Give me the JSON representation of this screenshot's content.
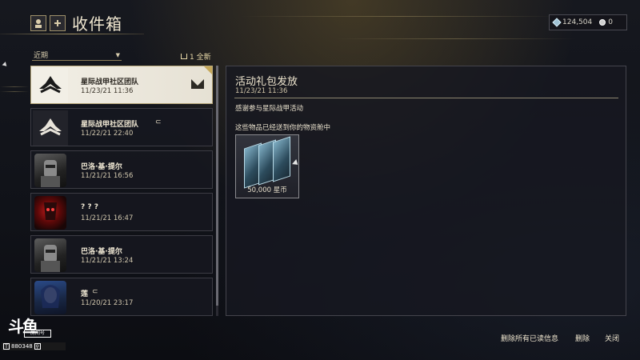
{
  "header": {
    "title": "收件箱",
    "icon_name": "profile-icon",
    "add_icon_name": "plus-icon"
  },
  "currency": {
    "credits": "124,504",
    "platinum": "0",
    "credit_icon": "credits-icon",
    "platinum_icon": "platinum-icon"
  },
  "filter": {
    "selected": "近期",
    "mark_all_label": "1 全新"
  },
  "messages": [
    {
      "sender": "星际战甲社区团队",
      "date": "11/23/21 11:36",
      "avatar": "lotus-logo",
      "selected": true,
      "unread": true
    },
    {
      "sender": "星际战甲社区团队",
      "date": "11/22/21 22:40",
      "avatar": "lotus-logo",
      "attachment": true
    },
    {
      "sender": "巴洛·基·提尔",
      "date": "11/21/21 16:56",
      "avatar": "warrior-portrait"
    },
    {
      "sender": "? ? ?",
      "date": "11/21/21 16:47",
      "avatar": "red-mask-portrait"
    },
    {
      "sender": "巴洛·基·提尔",
      "date": "11/21/21 13:24",
      "avatar": "warrior-portrait"
    },
    {
      "sender": "莲",
      "date": "11/20/21 23:17",
      "avatar": "lotus-portrait",
      "attachment": true
    }
  ],
  "detail": {
    "title": "活动礼包发放",
    "date": "11/23/21 11:36",
    "body1": "感谢参与星际战甲活动",
    "body2": "这些物品已经送到你的物资舱中",
    "reward": {
      "label": "50,000 星币",
      "icon": "credits-stack-icon"
    }
  },
  "footer": {
    "delete_read_label": "删除所有已读信息",
    "delete_label": "删除",
    "close_label": "关闭"
  },
  "watermark": {
    "logo": "斗鱼",
    "room_label": "房间号",
    "room_number": "880348"
  },
  "colors": {
    "accent_gold": "#c5a85a",
    "selected_bg": "#f2efe6",
    "panel_bg": "#16181f"
  }
}
